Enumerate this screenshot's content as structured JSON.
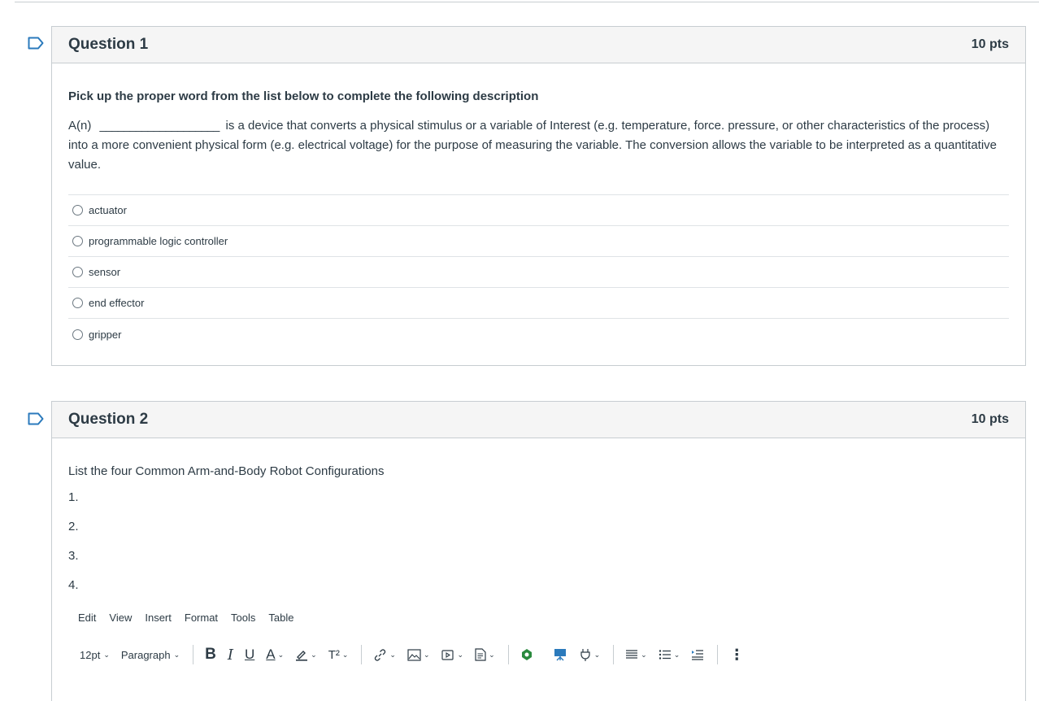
{
  "questions": [
    {
      "title": "Question 1",
      "points": "10 pts",
      "prompt": "Pick up the proper word from the list below to complete the following description",
      "description_start": "A(n)",
      "description_blank": "____________________",
      "description_rest": "is a device that converts a physical stimulus or a variable of Interest  (e.g. temperature, force. pressure, or other characteristics of the process) into a more convenient physical form (e.g. electrical voltage) for the purpose of measuring the variable. The conversion allows the variable to be interpreted as a quantitative value.",
      "answers": [
        "actuator",
        "programmable logic controller",
        "sensor",
        "end effector",
        "gripper"
      ]
    },
    {
      "title": "Question 2",
      "points": "10 pts",
      "prompt": "List the four Common Arm-and-Body Robot Configurations",
      "list": [
        "1.",
        "2.",
        "3.",
        "4."
      ]
    }
  ],
  "editor": {
    "menu": [
      "Edit",
      "View",
      "Insert",
      "Format",
      "Tools",
      "Table"
    ],
    "font_size": "12pt",
    "block_format": "Paragraph",
    "bold_glyph": "B",
    "italic_glyph": "I",
    "underline_glyph": "U",
    "text_color_glyph": "A",
    "superscript_glyph": "T²",
    "more_glyph": "⋮"
  },
  "colors": {
    "border": "#c7cdd1",
    "header_bg": "#f5f5f5",
    "text": "#2d3b45",
    "flag": "#2b7abc",
    "editor_focus": "#d0021b"
  }
}
